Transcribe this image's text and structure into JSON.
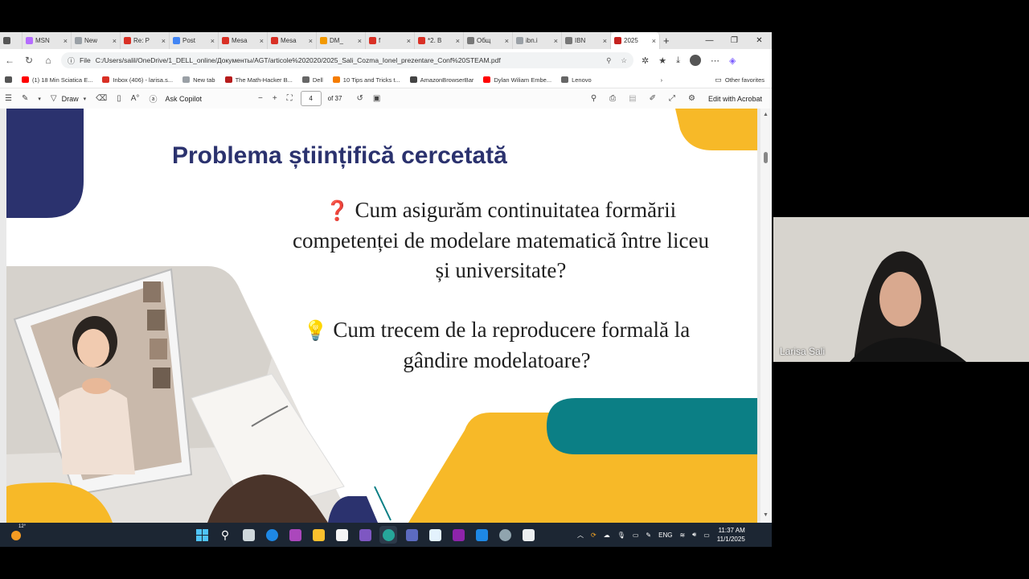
{
  "browser": {
    "tabs": [
      {
        "label": "MSN",
        "color": "#b56cff",
        "active": false
      },
      {
        "label": "New",
        "color": "#9aa0a6",
        "active": false
      },
      {
        "label": "Re: P",
        "color": "#d93025",
        "active": false
      },
      {
        "label": "Post",
        "color": "#4285f4",
        "active": false
      },
      {
        "label": "Mesa",
        "color": "#d93025",
        "active": false
      },
      {
        "label": "Mesa",
        "color": "#d93025",
        "active": false
      },
      {
        "label": "DM_",
        "color": "#f29900",
        "active": false
      },
      {
        "label": "f",
        "color": "#d93025",
        "active": false
      },
      {
        "label": "*2. B",
        "color": "#d93025",
        "active": false
      },
      {
        "label": "Общ",
        "color": "#777777",
        "active": false
      },
      {
        "label": "ibn.i",
        "color": "#9aa0a6",
        "active": false
      },
      {
        "label": "IBN",
        "color": "#777777",
        "active": false
      },
      {
        "label": "2025",
        "color": "#c5221f",
        "active": true
      }
    ],
    "new_tab": "+",
    "window_controls": {
      "minimize": "—",
      "maximize": "❐",
      "close": "✕"
    },
    "address": {
      "scheme": "File",
      "url": "C:/Users/salil/OneDrive/1_DELL_online/Документы/AGT/articole%202020/2025_Sali_Cozma_Ionel_prezentare_Conf%20STEAM.pdf"
    },
    "bookmarks": [
      {
        "label": "(1) 18 Min Sciatica E...",
        "color": "#ff0000"
      },
      {
        "label": "Inbox (406) - larisa.s...",
        "color": "#d93025"
      },
      {
        "label": "New tab",
        "color": "#9aa0a6"
      },
      {
        "label": "The Math-Hacker B...",
        "color": "#b71c1c"
      },
      {
        "label": "Dell",
        "color": "#666666"
      },
      {
        "label": "10 Tips and Tricks t...",
        "color": "#f57c00"
      },
      {
        "label": "AmazonBrowserBar",
        "color": "#444444"
      },
      {
        "label": "Dylan Wiliam Embe...",
        "color": "#ff0000"
      },
      {
        "label": "Lenovo",
        "color": "#666666"
      }
    ],
    "other_favorites": "Other favorites"
  },
  "pdf_toolbar": {
    "draw": "Draw",
    "ask_copilot": "Ask Copilot",
    "page_current": "4",
    "page_total": "of 37",
    "edit_acrobat": "Edit with Acrobat"
  },
  "slide": {
    "title": "Problema științifică cercetată",
    "question1": "Cum asigurăm continuitatea formării competenței de modelare matematică între liceu și universitate?",
    "question2": "Cum trecem de la reproducere formală la gândire modelatoare?",
    "colors": {
      "navy": "#2b326e",
      "teal": "#0b7f85",
      "yellow": "#f7b928"
    }
  },
  "taskbar": {
    "weather": "12°",
    "language": "ENG",
    "time": "11:37 AM",
    "date": "11/1/2025"
  },
  "webcam": {
    "name": "Larisa Sali"
  }
}
